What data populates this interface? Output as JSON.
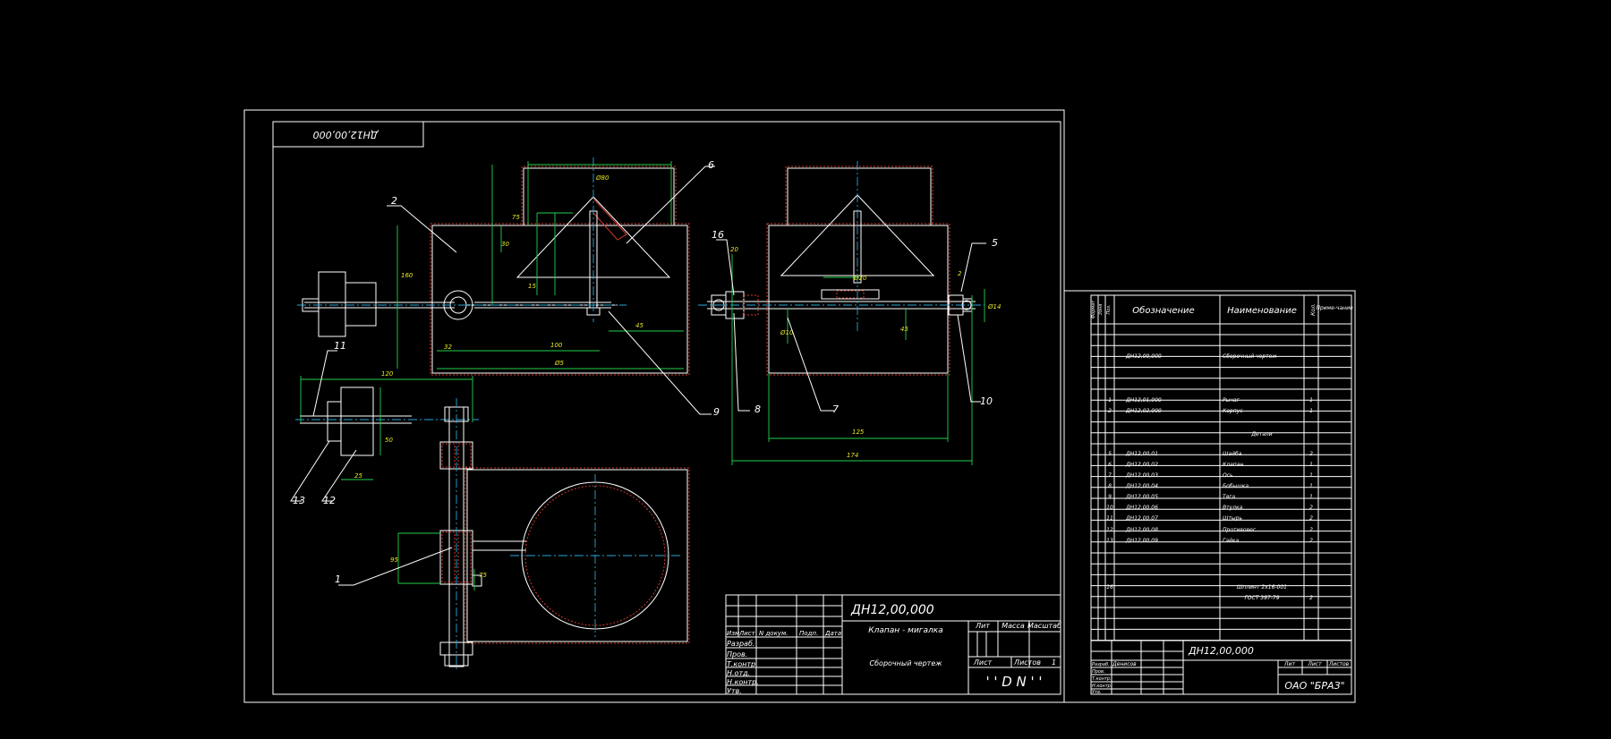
{
  "drawing": {
    "main_stamp_code": "ДН12,00,000",
    "rotated_code": "ДН12,00,000",
    "title_name": "Клапан - мигалка",
    "title_doc": "Сборочный чертеж",
    "logo_text": "' ' D N ' '",
    "header_cells": [
      "Изм",
      "Лист",
      "N докум.",
      "Подп.",
      "Дата"
    ],
    "role_labels": [
      "Разраб.",
      "Пров.",
      "Т.контр.",
      "Н.отд.",
      "Н.контр.",
      "Утв."
    ],
    "lit_label": "Лит",
    "massa_label": "Масса",
    "masshtab_label": "Масштаб",
    "list_label": "Лист",
    "listov_label": "Листов",
    "listov_value": "1",
    "leaders": [
      "1",
      "2",
      "5",
      "6",
      "7",
      "8",
      "9",
      "10",
      "11",
      "12",
      "13",
      "16"
    ]
  },
  "spec": {
    "col_headers": {
      "format": "Формат",
      "zone": "Зона",
      "pos": "Поз.",
      "designation": "Обозначение",
      "name": "Наименование",
      "qty": "Кол.",
      "note": "Приме-чание"
    },
    "rows": [
      {
        "pos": "",
        "designation": "ДН12,00,000",
        "name": "Сборочный чертеж",
        "qty": ""
      },
      {
        "pos": "1",
        "designation": "ДН12,01,000",
        "name": "Рычаг",
        "qty": "1"
      },
      {
        "pos": "2",
        "designation": "ДН12,02,000",
        "name": "Корпус",
        "qty": "1"
      },
      {
        "pos": "",
        "designation": "",
        "name": "Детали",
        "qty": ""
      },
      {
        "pos": "5",
        "designation": "ДН12,00,01",
        "name": "Шайба",
        "qty": "2"
      },
      {
        "pos": "6",
        "designation": "ДН12,00,02",
        "name": "Клапан",
        "qty": "1"
      },
      {
        "pos": "7",
        "designation": "ДН12,00,03",
        "name": "Ось",
        "qty": "1"
      },
      {
        "pos": "8",
        "designation": "ДН12,00,04",
        "name": "Бобышка",
        "qty": "1"
      },
      {
        "pos": "9",
        "designation": "ДН12,00,05",
        "name": "Тяга",
        "qty": "1"
      },
      {
        "pos": "10",
        "designation": "ДН12,00,06",
        "name": "Втулка",
        "qty": "2"
      },
      {
        "pos": "11",
        "designation": "ДН12,00,07",
        "name": "Штырь",
        "qty": "2"
      },
      {
        "pos": "12",
        "designation": "ДН12,00,08",
        "name": "Противовес",
        "qty": "2"
      },
      {
        "pos": "13",
        "designation": "ДН12,00,09",
        "name": "Гайка",
        "qty": "2"
      },
      {
        "pos": "16",
        "designation": "",
        "name": "Шплинт 2х16-001",
        "qty": ""
      },
      {
        "pos": "",
        "designation": "",
        "name": "ГОСТ 397-79",
        "qty": "2"
      }
    ],
    "stamp_code": "ДН12,00,000",
    "stamp_roles": [
      "Разраб.",
      "Пров.",
      "Т.контр.",
      "Н.контр.",
      "Утв."
    ],
    "stamp_author": "Денисов",
    "stamp_lit": "Лит",
    "stamp_list": "Лист",
    "stamp_listov": "Листов",
    "company": "ОАО \"БРАЗ\""
  }
}
